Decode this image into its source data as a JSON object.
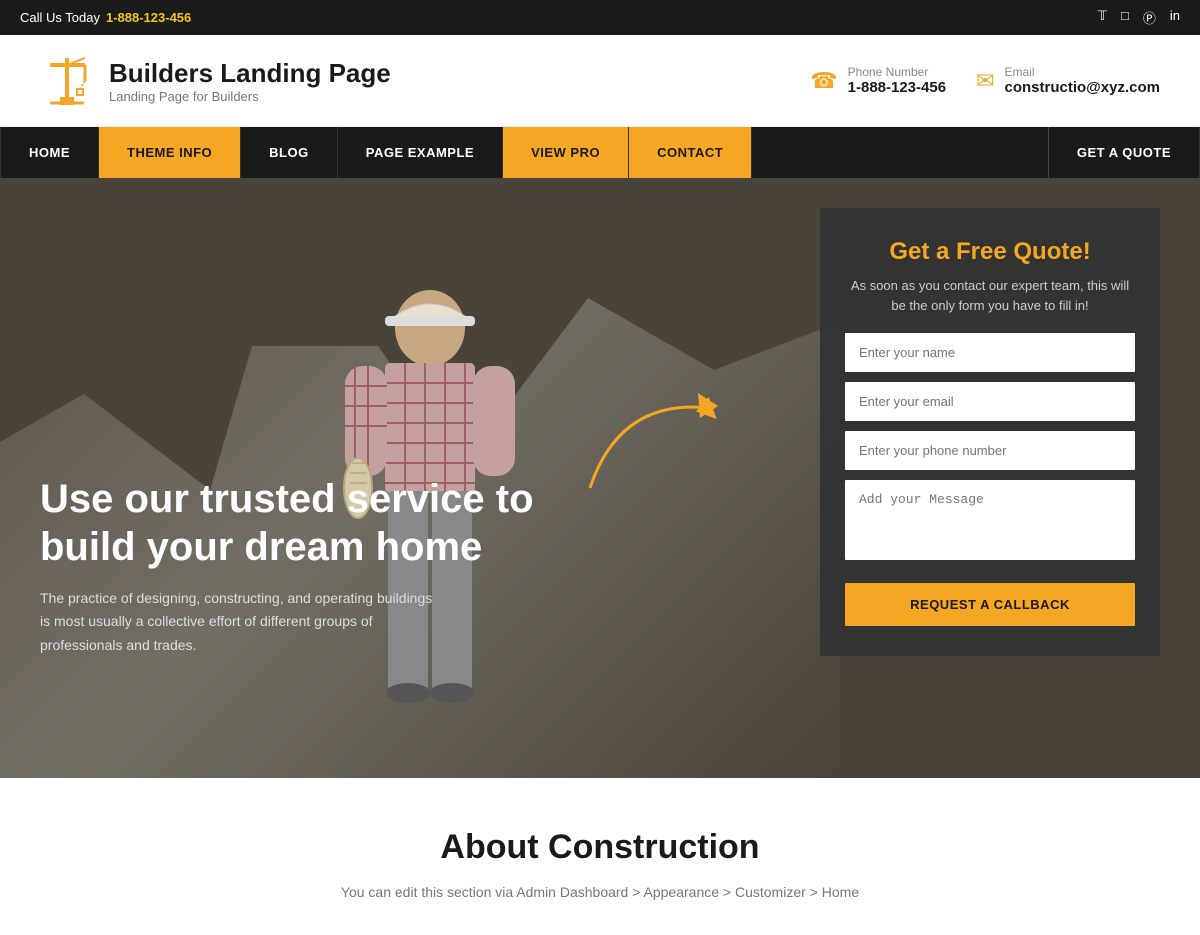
{
  "topbar": {
    "call_label": "Call Us Today",
    "phone": "1-888-123-456",
    "social_icons": [
      "f",
      "t",
      "ig",
      "p",
      "in"
    ]
  },
  "header": {
    "logo_title": "Builders Landing Page",
    "logo_subtitle": "Landing Page for Builders",
    "phone_label": "Phone Number",
    "phone": "1-888-123-456",
    "email_label": "Email",
    "email": "constructio@xyz.com"
  },
  "nav": {
    "items": [
      {
        "label": "HOME",
        "style": "dark"
      },
      {
        "label": "THEME INFO",
        "style": "yellow"
      },
      {
        "label": "BLOG",
        "style": "dark"
      },
      {
        "label": "PAGE EXAMPLE",
        "style": "dark"
      },
      {
        "label": "VIEW PRO",
        "style": "yellow"
      },
      {
        "label": "CONTACT",
        "style": "yellow"
      },
      {
        "label": "GET A QUOTE",
        "style": "dark"
      }
    ]
  },
  "hero": {
    "heading": "Use our trusted service to build your dream home",
    "description": "The practice of designing, constructing, and operating buildings is most usually a collective effort of different groups of professionals and trades.",
    "form": {
      "title": "Get a Free Quote!",
      "subtitle": "As soon as you contact our expert team, this will be the only form you have to fill in!",
      "name_placeholder": "Enter your name",
      "email_placeholder": "Enter your email",
      "phone_placeholder": "Enter your phone number",
      "message_placeholder": "Add your Message",
      "button_label": "REQUEST A CALLBACK"
    }
  },
  "about": {
    "heading": "About Construction",
    "description": "You can edit this section via Admin Dashboard > Appearance > Customizer > Home"
  }
}
